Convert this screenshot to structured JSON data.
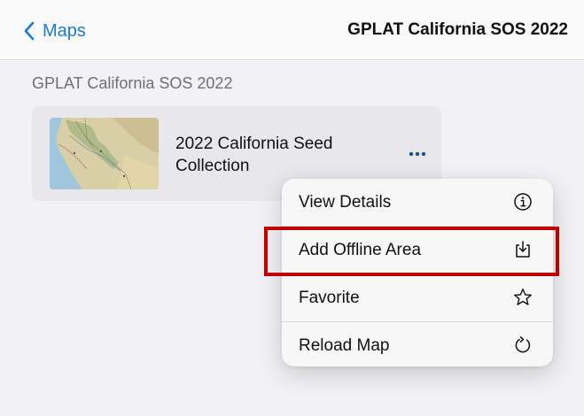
{
  "navbar": {
    "back_label": "Maps",
    "title": "GPLAT California SOS 2022",
    "back_icon": "chevron-left-icon",
    "accent_color": "#1a7bd8"
  },
  "section": {
    "header": "GPLAT California SOS 2022"
  },
  "map_card": {
    "title": "2022 California Seed Collection",
    "more_icon": "ellipsis-icon"
  },
  "menu": {
    "items": [
      {
        "label": "View Details",
        "icon": "info-icon"
      },
      {
        "label": "Add Offline Area",
        "icon": "download-icon"
      },
      {
        "label": "Favorite",
        "icon": "star-icon"
      },
      {
        "label": "Reload Map",
        "icon": "reload-icon"
      }
    ]
  },
  "highlight": {
    "color": "#c00000",
    "target": "Add Offline Area"
  }
}
